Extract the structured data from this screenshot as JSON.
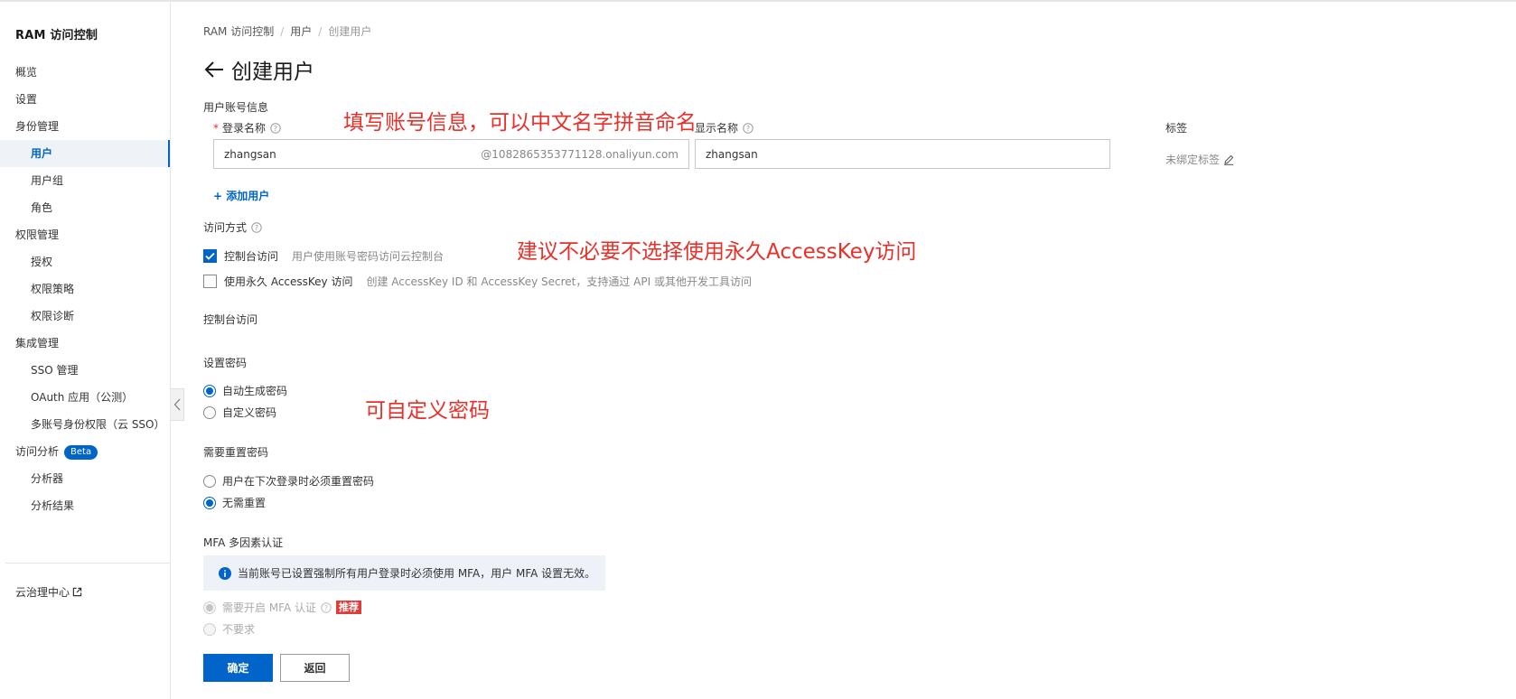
{
  "sidebar": {
    "title": "RAM 访问控制",
    "items": [
      {
        "label": "概览"
      },
      {
        "label": "设置"
      },
      {
        "label": "身份管理"
      },
      {
        "label": "用户"
      },
      {
        "label": "用户组"
      },
      {
        "label": "角色"
      },
      {
        "label": "权限管理"
      },
      {
        "label": "授权"
      },
      {
        "label": "权限策略"
      },
      {
        "label": "权限诊断"
      },
      {
        "label": "集成管理"
      },
      {
        "label": "SSO 管理"
      },
      {
        "label": "OAuth 应用（公测）"
      },
      {
        "label": "多账号身份权限（云 SSO）"
      },
      {
        "label": "访问分析"
      },
      {
        "label": "分析器"
      },
      {
        "label": "分析结果"
      }
    ],
    "beta_badge": "Beta",
    "cloud_governance": "云治理中心"
  },
  "breadcrumb": {
    "items": [
      "RAM 访问控制",
      "用户",
      "创建用户"
    ],
    "separator": "/"
  },
  "page": {
    "title": "创建用户"
  },
  "account_info": {
    "section_label": "用户账号信息",
    "login_name_label": "登录名称",
    "login_name_value": "zhangsan",
    "login_name_suffix": "@1082865353771128.onaliyun.com",
    "display_name_label": "显示名称",
    "display_name_value": "zhangsan",
    "tag_label": "标签",
    "tag_value": "未绑定标签",
    "add_user": "+ 添加用户"
  },
  "access_mode": {
    "label": "访问方式",
    "console": {
      "label": "控制台访问",
      "desc": "用户使用账号密码访问云控制台",
      "checked": true
    },
    "accesskey": {
      "label": "使用永久 AccessKey 访问",
      "desc": "创建 AccessKey ID 和 AccessKey Secret，支持通过 API 或其他开发工具访问",
      "checked": false
    }
  },
  "console_access": {
    "title": "控制台访问"
  },
  "password": {
    "title": "设置密码",
    "options": [
      {
        "label": "自动生成密码",
        "checked": true
      },
      {
        "label": "自定义密码",
        "checked": false
      }
    ]
  },
  "reset_password": {
    "title": "需要重置密码",
    "options": [
      {
        "label": "用户在下次登录时必须重置密码",
        "checked": false
      },
      {
        "label": "无需重置",
        "checked": true
      }
    ]
  },
  "mfa": {
    "title": "MFA 多因素认证",
    "alert": "当前账号已设置强制所有用户登录时必须使用 MFA，用户 MFA 设置无效。",
    "options": [
      {
        "label": "需要开启 MFA 认证",
        "checked": true,
        "disabled": true
      },
      {
        "label": "不要求",
        "checked": false,
        "disabled": true
      }
    ],
    "recommend_badge": "推荐"
  },
  "buttons": {
    "confirm": "确定",
    "back": "返回"
  },
  "annotations": {
    "account": "填写账号信息，可以中文名字拼音命名",
    "accesskey": "建议不必要不选择使用永久AccessKey访问",
    "password": "可自定义密码"
  },
  "colors": {
    "primary": "#0064c8",
    "annotation": "#e8302a",
    "recommend": "#e23c39"
  }
}
